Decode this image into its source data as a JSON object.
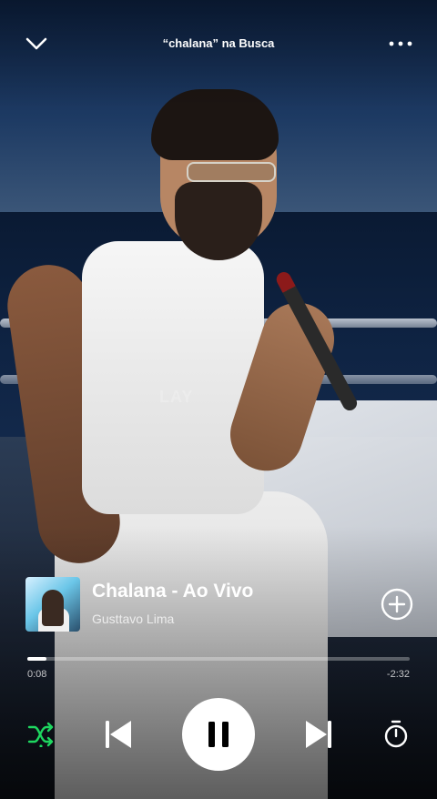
{
  "header": {
    "context_label": "“chalana” na Busca"
  },
  "background": {
    "watermark_text": "LAY"
  },
  "track": {
    "title": "Chalana - Ao Vivo",
    "artist": "Gusttavo Lima"
  },
  "playback": {
    "elapsed": "0:08",
    "remaining": "-2:32",
    "progress_fraction": 0.05
  },
  "icons": {
    "collapse": "chevron-down-icon",
    "more": "more-options-icon",
    "add": "add-circle-icon",
    "shuffle": "shuffle-icon",
    "previous": "skip-previous-icon",
    "pause": "pause-icon",
    "next": "skip-next-icon",
    "timer": "sleep-timer-icon"
  },
  "colors": {
    "accent": "#1ed760",
    "foreground": "#ffffff"
  }
}
